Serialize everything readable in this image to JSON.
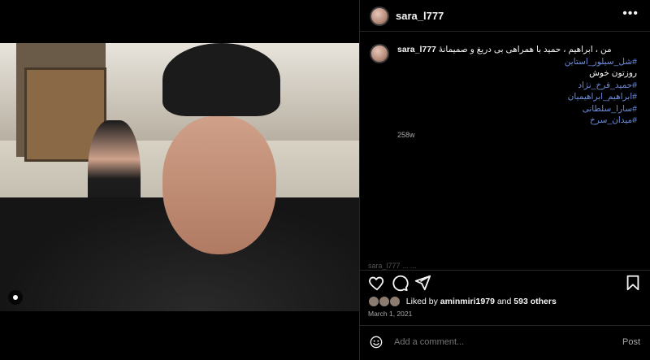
{
  "post": {
    "username": "sara_l777",
    "more_icon": "more-icon",
    "caption": {
      "username": "sara_l777",
      "text": "من ، ابراهیم ، حمید با همراهی بی دریغ و صمیمانهٔ",
      "tag1": "#شل_سیلور_استاین",
      "plain1": "روزتون خوش",
      "tag2": "#حمید_فرخ_نژاد",
      "tag3": "#ابراهیم_ابراهیمیان",
      "tag4": "#سارا_سلطانی",
      "tag5": "#میدان_سرخ",
      "time": "258w"
    },
    "faded_comment": "sara_l777 ... ...",
    "likes": {
      "prefix": "Liked by ",
      "user": "aminmiri1979",
      "middle": " and ",
      "others": "593 others"
    },
    "date": "March 1, 2021",
    "comment_placeholder": "Add a comment...",
    "post_label": "Post"
  },
  "icons": [
    "heart-icon",
    "comment-icon",
    "share-icon",
    "bookmark-icon",
    "emoji-icon",
    "person-tag-icon"
  ],
  "colors": {
    "link": "#6c8bd9",
    "muted": "#a8a8a8",
    "background": "#000000"
  }
}
